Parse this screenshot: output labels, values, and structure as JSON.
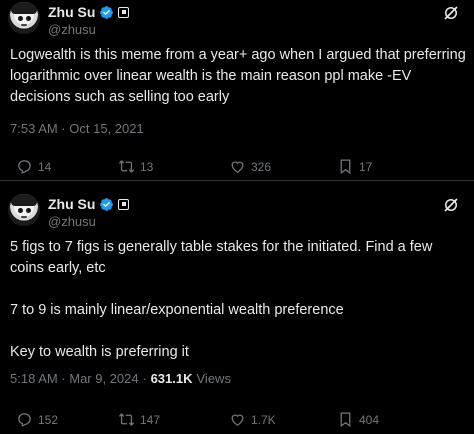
{
  "tweets": [
    {
      "author": {
        "name": "Zhu Su",
        "handle": "@zhusu"
      },
      "text": "Logwealth is this meme from a year+ ago when I argued that preferring logarithmic over linear wealth is the main reason ppl make -EV decisions such as selling too early",
      "time": "7:53 AM · Oct 15, 2021",
      "views": null,
      "views_label": null,
      "stats": {
        "replies": "14",
        "retweets": "13",
        "likes": "326",
        "bookmarks": "17"
      }
    },
    {
      "author": {
        "name": "Zhu Su",
        "handle": "@zhusu"
      },
      "text": "5 figs to 7 figs is generally table stakes for the initiated. Find a few coins early, etc\n\n7 to 9 is mainly linear/exponential wealth preference\n\nKey to wealth is preferring it",
      "time": "5:18 AM · Mar 9, 2024 ·",
      "views": "631.1K",
      "views_label": "Views",
      "stats": {
        "replies": "152",
        "retweets": "147",
        "likes": "1.7K",
        "bookmarks": "404"
      }
    }
  ],
  "colors": {
    "background": "#000000",
    "text": "#e7e9ea",
    "muted": "#71767b",
    "verified": "#1d9bf0",
    "divider": "#2f3336"
  },
  "icons": [
    "verified-badge-icon",
    "affiliate-badge-icon",
    "grok-icon",
    "reply-icon",
    "retweet-icon",
    "like-icon",
    "bookmark-icon"
  ]
}
